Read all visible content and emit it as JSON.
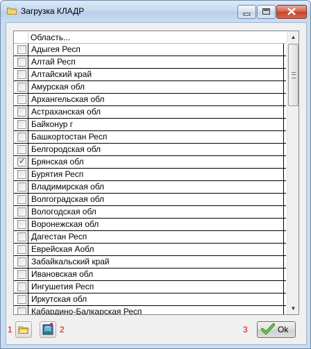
{
  "window": {
    "title": "Загрузка КЛАДР"
  },
  "grid": {
    "header": "Область...",
    "rows": [
      {
        "label": "Адыгея Респ",
        "checked": false
      },
      {
        "label": "Алтай Респ",
        "checked": false
      },
      {
        "label": "Алтайский край",
        "checked": false
      },
      {
        "label": "Амурская обл",
        "checked": false
      },
      {
        "label": "Архангельская обл",
        "checked": false
      },
      {
        "label": "Астраханская обл",
        "checked": false
      },
      {
        "label": "Байконур г",
        "checked": false
      },
      {
        "label": "Башкортостан Респ",
        "checked": false
      },
      {
        "label": "Белгородская обл",
        "checked": false
      },
      {
        "label": "Брянская обл",
        "checked": true
      },
      {
        "label": "Бурятия Респ",
        "checked": false
      },
      {
        "label": "Владимирская обл",
        "checked": false
      },
      {
        "label": "Волгоградская обл",
        "checked": false
      },
      {
        "label": "Вологодская обл",
        "checked": false
      },
      {
        "label": "Воронежская обл",
        "checked": false
      },
      {
        "label": "Дагестан Респ",
        "checked": false
      },
      {
        "label": "Еврейская Аобл",
        "checked": false
      },
      {
        "label": "Забайкальский край",
        "checked": false
      },
      {
        "label": "Ивановская обл",
        "checked": false
      },
      {
        "label": "Ингушетия Респ",
        "checked": false
      },
      {
        "label": "Иркутская обл",
        "checked": false
      },
      {
        "label": "Кабардино-Балкарская Респ",
        "checked": false
      }
    ]
  },
  "markers": {
    "one": "1",
    "two": "2",
    "three": "3"
  },
  "buttons": {
    "open_icon": "folder-open-icon",
    "import_icon": "database-import-icon",
    "ok_label": "Ok",
    "ok_icon": "checkmark-icon"
  }
}
